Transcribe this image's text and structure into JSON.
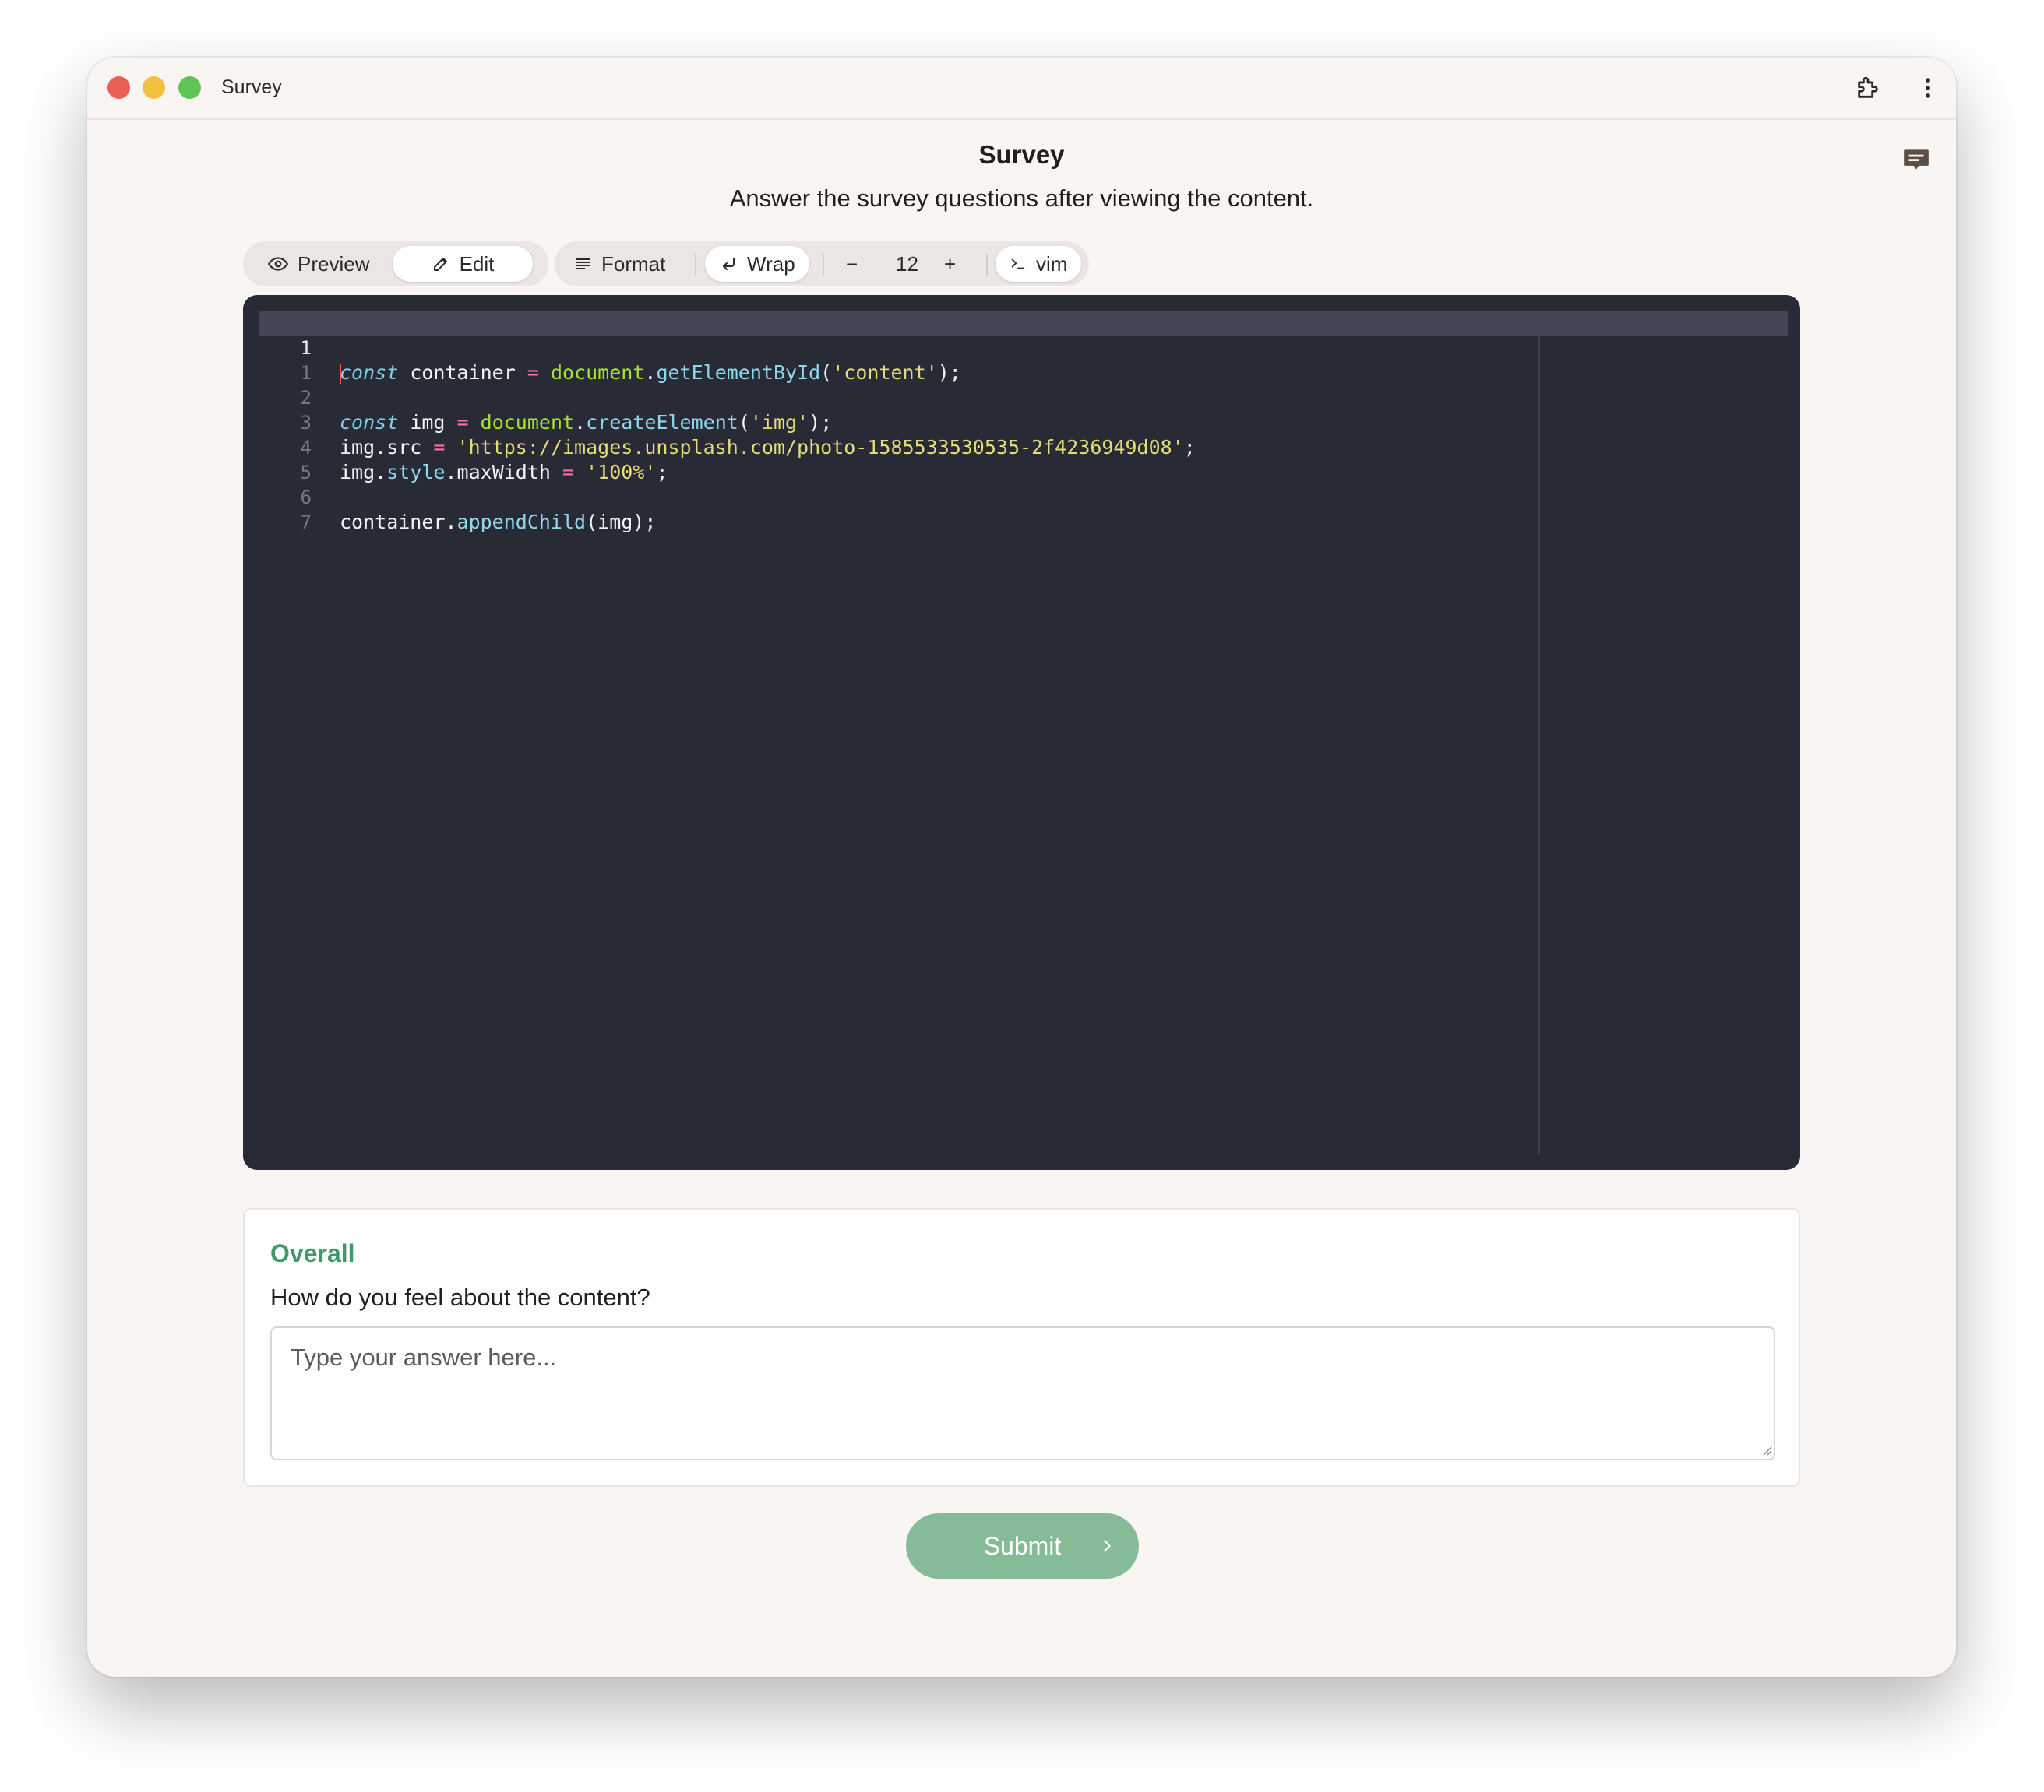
{
  "window": {
    "title": "Survey"
  },
  "page": {
    "title": "Survey",
    "subtitle": "Answer the survey questions after viewing the content."
  },
  "toolbar": {
    "preview_label": "Preview",
    "edit_label": "Edit",
    "active_mode": "Edit",
    "format_label": "Format",
    "wrap_label": "Wrap",
    "font_size": "12",
    "decrease_label": "−",
    "increase_label": "+",
    "vim_label": "vim"
  },
  "editor": {
    "active_line_number": "1",
    "lines": [
      {
        "num": "1",
        "text": "const container = document.getElementById('content');"
      },
      {
        "num": "1",
        "text": ""
      },
      {
        "num": "2",
        "text": "const img = document.createElement('img');"
      },
      {
        "num": "3",
        "text": "img.src = 'https://images.unsplash.com/photo-1585533530535-2f4236949d08';"
      },
      {
        "num": "4",
        "text": "img.style.maxWidth = '100%';"
      },
      {
        "num": "5",
        "text": ""
      },
      {
        "num": "6",
        "text": "container.appendChild(img);"
      },
      {
        "num": "7",
        "text": ""
      }
    ]
  },
  "question": {
    "heading": "Overall",
    "text": "How do you feel about the content?",
    "placeholder": "Type your answer here...",
    "value": ""
  },
  "submit": {
    "label": "Submit"
  },
  "colors": {
    "accent": "#3f9a68",
    "submit_bg": "#86bb98",
    "editor_bg": "#282b36",
    "window_bg": "#f8f5f3"
  },
  "icons": [
    "extension-icon",
    "more-vertical-icon",
    "chat-feedback-icon",
    "eye-icon",
    "pencil-icon",
    "format-lines-icon",
    "wrap-arrow-icon",
    "terminal-icon",
    "chevron-right-icon"
  ]
}
